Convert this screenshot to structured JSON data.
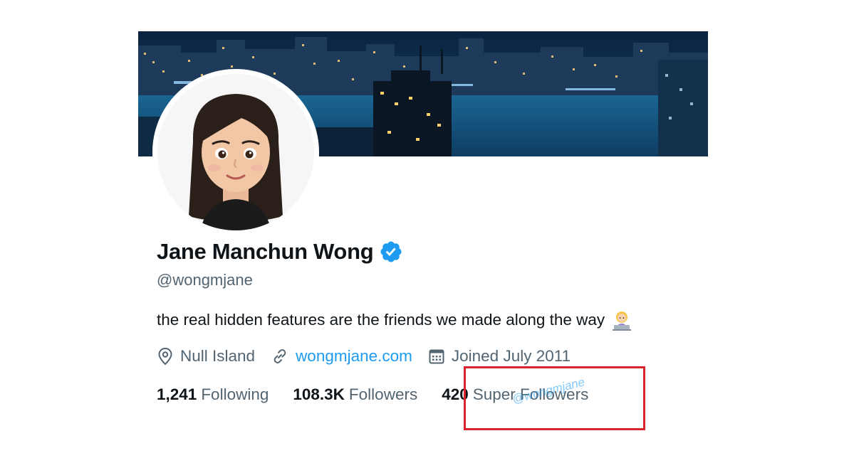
{
  "profile": {
    "display_name": "Jane Manchun Wong",
    "handle": "@wongmjane",
    "bio": "the real hidden features are the friends we made along the way",
    "verified_icon": "verified-badge-icon",
    "bio_emoji": "woman-technologist-emoji"
  },
  "meta": {
    "location": "Null Island",
    "website": "wongmjane.com",
    "joined": "Joined July 2011",
    "icons": [
      "location-pin-icon",
      "link-icon",
      "calendar-icon"
    ]
  },
  "stats": {
    "following_count": "1,241",
    "following_label": "Following",
    "followers_count": "108.3K",
    "followers_label": "Followers",
    "super_followers_count": "420",
    "super_followers_label": "Super Followers"
  },
  "watermark": "@wongmjane",
  "colors": {
    "accent": "#1d9bf0",
    "text_primary": "#0f1419",
    "text_secondary": "#536471",
    "highlight": "#d9242e"
  }
}
